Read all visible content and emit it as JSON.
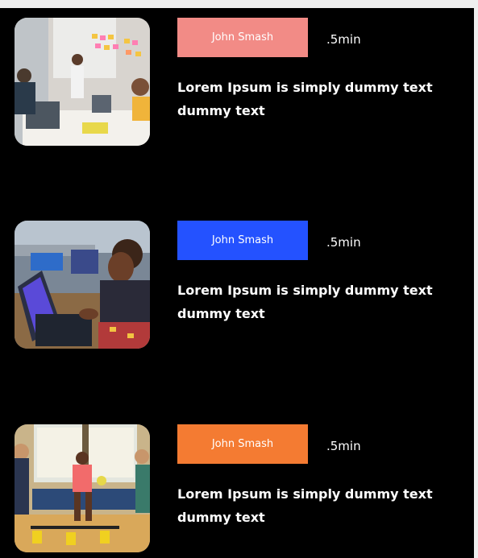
{
  "articles": [
    {
      "author": "John Smash",
      "duration": ".5min",
      "headline": "Lorem Ipsum is simply dummy text dummy text",
      "badge_color": "#f28b86",
      "thumbnail": "office-meeting-photo"
    },
    {
      "author": "John Smash",
      "duration": ".5min",
      "headline": "Lorem Ipsum is simply dummy text dummy text",
      "badge_color": "#2452ff",
      "thumbnail": "laptop-students-photo"
    },
    {
      "author": "John Smash",
      "duration": ".5min",
      "headline": "Lorem Ipsum is simply dummy text dummy text",
      "badge_color": "#f47b32",
      "thumbnail": "kids-gym-photo"
    }
  ]
}
